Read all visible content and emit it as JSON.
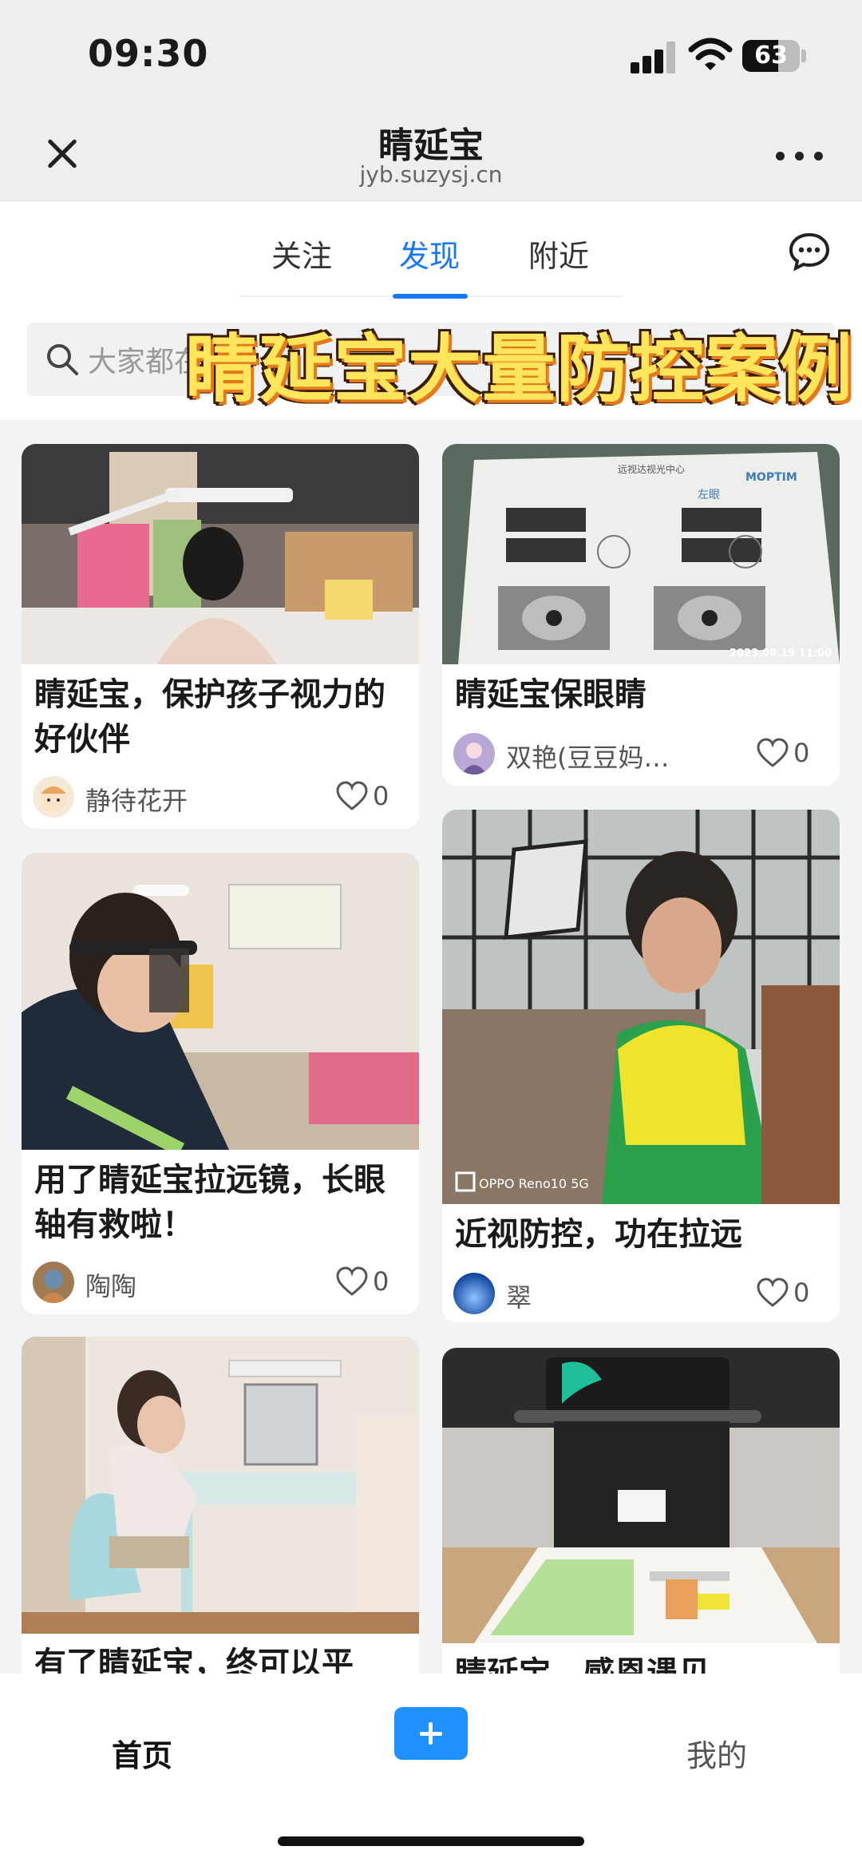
{
  "status": {
    "time": "09:30",
    "battery": "63",
    "battery_level": 0.63
  },
  "titlebar": {
    "title": "睛延宝",
    "url": "jyb.suzysj.cn"
  },
  "tabs": [
    {
      "label": "关注",
      "active": false
    },
    {
      "label": "发现",
      "active": true
    },
    {
      "label": "附近",
      "active": false
    }
  ],
  "search": {
    "placeholder": "大家都在"
  },
  "banner": "睛延宝大量防控案例",
  "feed": [
    {
      "title": "睛延宝，保护孩子视力的好伙伴",
      "author": "静待花开",
      "likes": "0"
    },
    {
      "title": "睛延宝保眼睛",
      "author": "双艳(豆豆妈…",
      "likes": "0"
    },
    {
      "title": "用了睛延宝拉远镜，长眼轴有救啦！",
      "author": "陶陶",
      "likes": "0"
    },
    {
      "title": "近视防控，功在拉远",
      "author": "翠",
      "likes": "0"
    },
    {
      "title": "有了睛延宝，终可以平",
      "author": "",
      "likes": ""
    },
    {
      "title": "睛延宝，感恩遇见",
      "author": "",
      "likes": ""
    }
  ],
  "photo_captions": {
    "report_date": "2023.08.19  11:00",
    "report_brand": "MOPTIM",
    "report_center": "远视达视光中心",
    "report_eye": "左眼",
    "phone_watermark": "OPPO Reno10 5G"
  },
  "bottom_nav": {
    "home": "首页",
    "mine": "我的"
  },
  "colors": {
    "accent": "#1677ff",
    "add_button": "#1e90ff",
    "banner": "#ffe55c"
  }
}
